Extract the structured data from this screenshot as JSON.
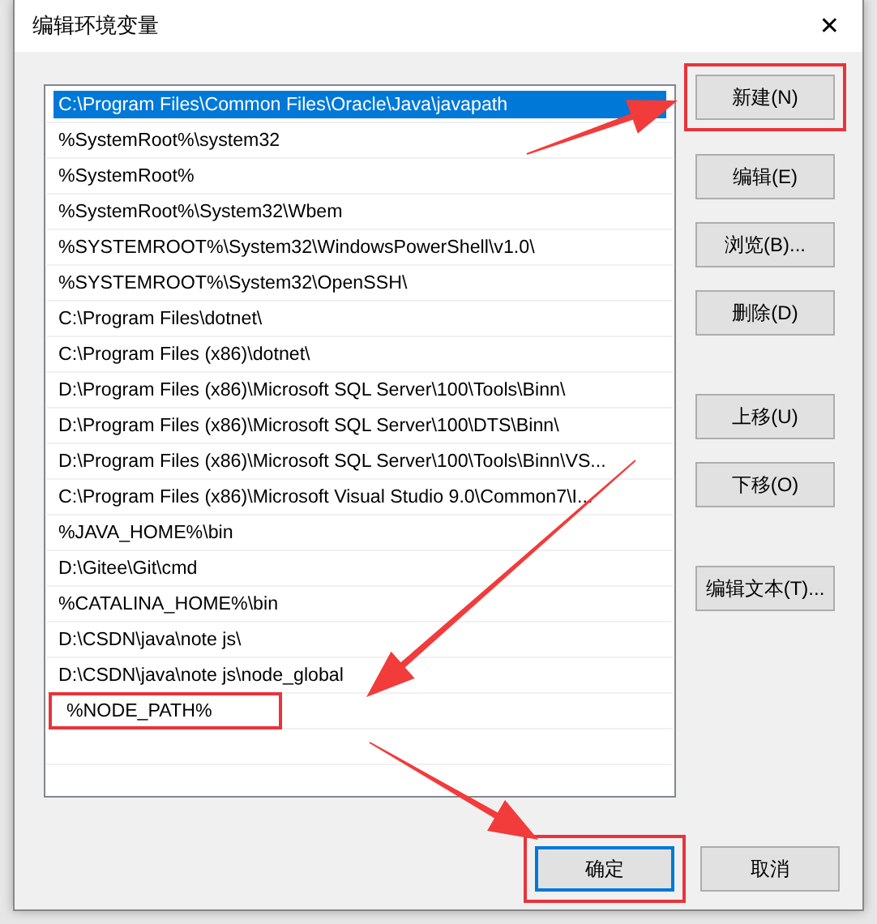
{
  "window": {
    "title": "编辑环境变量",
    "close": "✕"
  },
  "paths": [
    {
      "text": "C:\\Program Files\\Common Files\\Oracle\\Java\\javapath",
      "selected": true,
      "highlighted": false
    },
    {
      "text": "%SystemRoot%\\system32",
      "selected": false,
      "highlighted": false
    },
    {
      "text": "%SystemRoot%",
      "selected": false,
      "highlighted": false
    },
    {
      "text": "%SystemRoot%\\System32\\Wbem",
      "selected": false,
      "highlighted": false
    },
    {
      "text": "%SYSTEMROOT%\\System32\\WindowsPowerShell\\v1.0\\",
      "selected": false,
      "highlighted": false
    },
    {
      "text": "%SYSTEMROOT%\\System32\\OpenSSH\\",
      "selected": false,
      "highlighted": false
    },
    {
      "text": "C:\\Program Files\\dotnet\\",
      "selected": false,
      "highlighted": false
    },
    {
      "text": "C:\\Program Files (x86)\\dotnet\\",
      "selected": false,
      "highlighted": false
    },
    {
      "text": "D:\\Program Files (x86)\\Microsoft SQL Server\\100\\Tools\\Binn\\",
      "selected": false,
      "highlighted": false
    },
    {
      "text": "D:\\Program Files (x86)\\Microsoft SQL Server\\100\\DTS\\Binn\\",
      "selected": false,
      "highlighted": false
    },
    {
      "text": "D:\\Program Files (x86)\\Microsoft SQL Server\\100\\Tools\\Binn\\VS...",
      "selected": false,
      "highlighted": false
    },
    {
      "text": "C:\\Program Files (x86)\\Microsoft Visual Studio 9.0\\Common7\\I...",
      "selected": false,
      "highlighted": false
    },
    {
      "text": "%JAVA_HOME%\\bin",
      "selected": false,
      "highlighted": false
    },
    {
      "text": "D:\\Gitee\\Git\\cmd",
      "selected": false,
      "highlighted": false
    },
    {
      "text": "%CATALINA_HOME%\\bin",
      "selected": false,
      "highlighted": false
    },
    {
      "text": "D:\\CSDN\\java\\note js\\",
      "selected": false,
      "highlighted": false
    },
    {
      "text": "D:\\CSDN\\java\\note js\\node_global",
      "selected": false,
      "highlighted": false
    },
    {
      "text": "%NODE_PATH%",
      "selected": false,
      "highlighted": true
    }
  ],
  "side_button_groups": [
    [
      {
        "label": "新建(N)",
        "highlighted": true
      },
      {
        "label": "编辑(E)",
        "highlighted": false
      },
      {
        "label": "浏览(B)...",
        "highlighted": false
      },
      {
        "label": "删除(D)",
        "highlighted": false
      }
    ],
    [
      {
        "label": "上移(U)",
        "highlighted": false
      },
      {
        "label": "下移(O)",
        "highlighted": false
      }
    ],
    [
      {
        "label": "编辑文本(T)...",
        "highlighted": false
      }
    ]
  ],
  "footer_buttons": [
    {
      "label": "确定",
      "highlighted": true,
      "default": true
    },
    {
      "label": "取消",
      "highlighted": false,
      "default": false
    }
  ]
}
